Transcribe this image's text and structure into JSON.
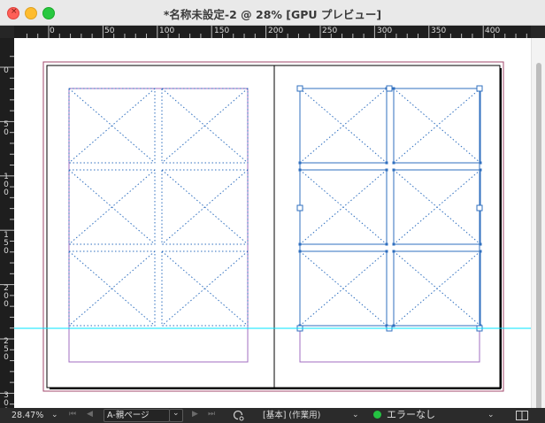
{
  "window": {
    "title": "*名称未設定-2 @ 28% [GPU プレビュー]",
    "close_glyph": "×"
  },
  "ruler_h": {
    "labels": [
      "0",
      "50",
      "100",
      "150",
      "200",
      "250",
      "300",
      "350",
      "400"
    ]
  },
  "ruler_v": {
    "labels": [
      "0",
      "50",
      "100",
      "150",
      "200",
      "250",
      "300"
    ]
  },
  "status": {
    "zoom": "28.47%",
    "zoom_chevron": "⌄",
    "page": "A-親ページ",
    "page_chevron": "⌄",
    "first_page": "⏮",
    "prev_page": "◀",
    "next_page": "▶",
    "last_page": "⏭",
    "workspace": "[基本] (作業用)",
    "workspace_chevron": "⌄",
    "preflight": "エラーなし",
    "preflight_chevron": "⌄",
    "preflight_color": "#24c242",
    "icons": [
      "preflight-status-icon",
      "page-status-icon",
      "panel-toggle-icon"
    ]
  },
  "colors": {
    "page_border": "#000000",
    "bleed": "#a0476b",
    "margin": "#a06cc0",
    "frame": "#2f6fbf",
    "guide": "#00e5ff"
  }
}
